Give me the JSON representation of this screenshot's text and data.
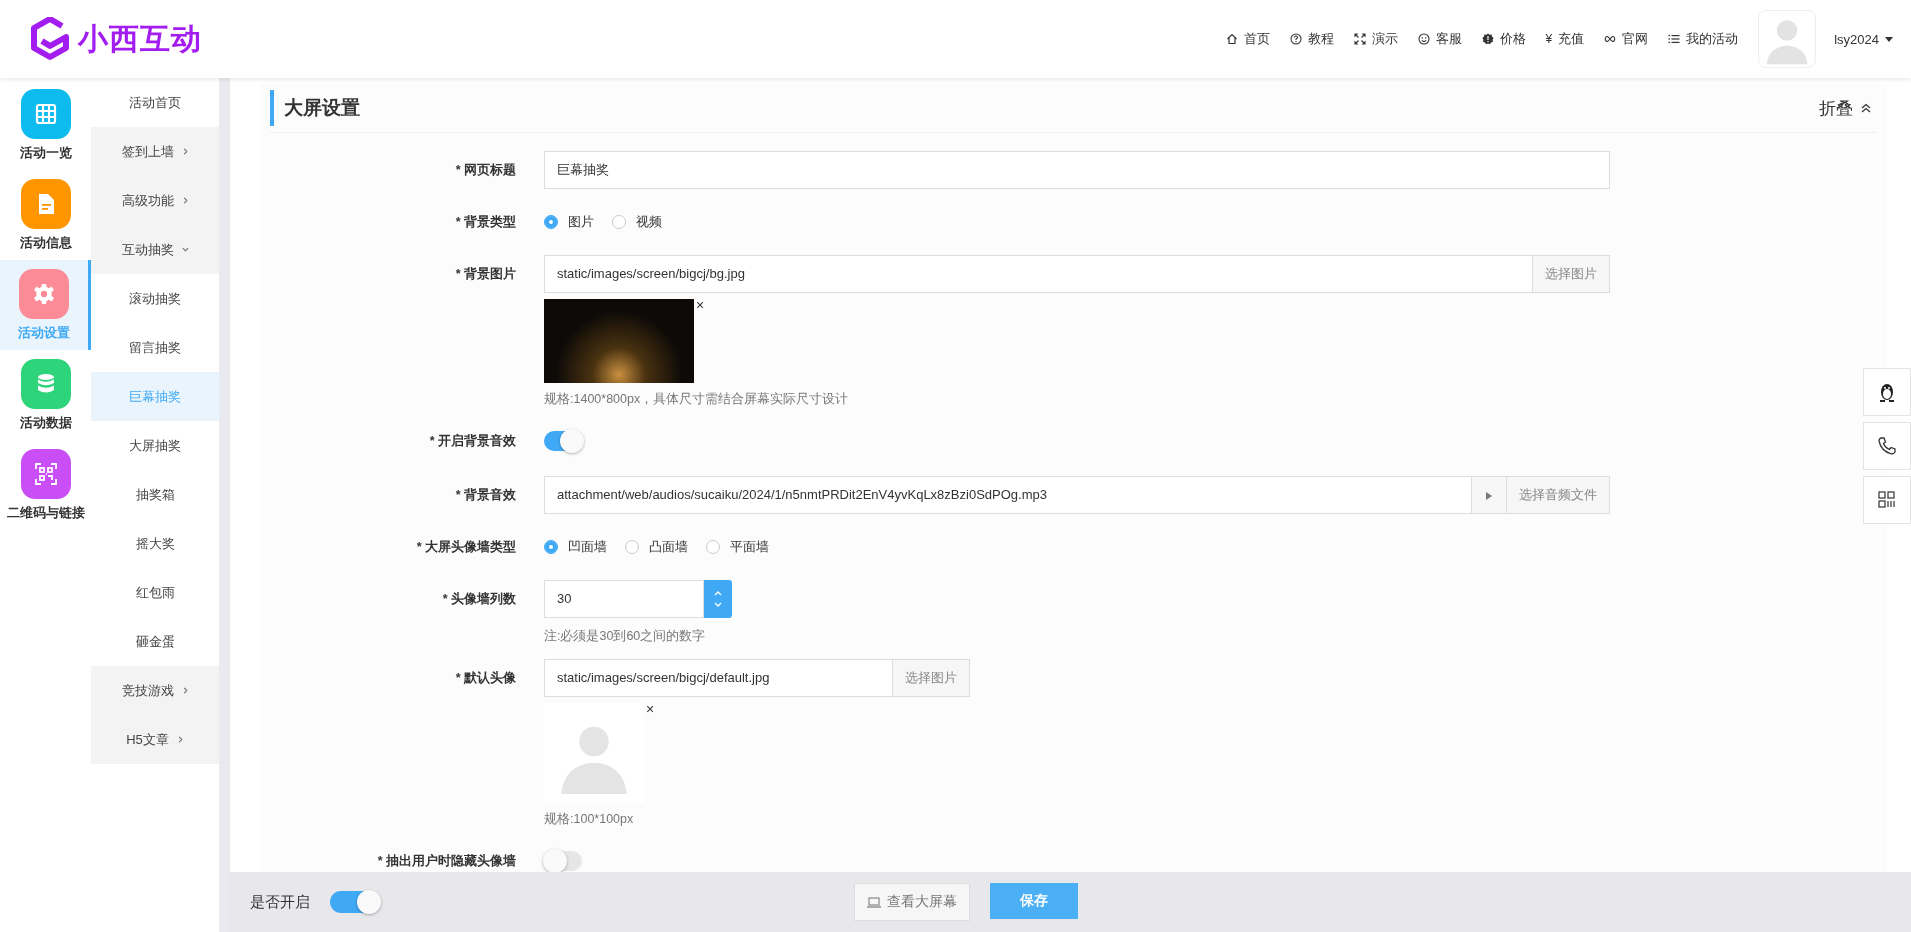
{
  "logo": {
    "text": "小西互动"
  },
  "top_nav": [
    {
      "label": "首页"
    },
    {
      "label": "教程"
    },
    {
      "label": "演示"
    },
    {
      "label": "客服"
    },
    {
      "label": "价格"
    },
    {
      "label": "充值",
      "glyph": "¥"
    },
    {
      "label": "官网"
    },
    {
      "label": "我的活动"
    }
  ],
  "user": {
    "name": "lsy2024"
  },
  "main_menu": [
    {
      "label": "活动一览",
      "color": "#0dbbee",
      "selected": false
    },
    {
      "label": "活动信息",
      "color": "#ff9500",
      "selected": false
    },
    {
      "label": "活动设置",
      "color": "#fd8a97",
      "selected": true
    },
    {
      "label": "活动数据",
      "color": "#2ed47a",
      "selected": false
    },
    {
      "label": "二维码与链接",
      "color": "#c94ef5",
      "selected": false
    }
  ],
  "sub_menu": [
    {
      "label": "活动首页",
      "selected": false
    },
    {
      "label": "签到上墙",
      "selected": false,
      "expanded": false
    },
    {
      "label": "高级功能",
      "selected": false,
      "expanded": false
    },
    {
      "label": "互动抽奖",
      "selected": false,
      "expanded": true,
      "children": [
        {
          "label": "滚动抽奖",
          "selected": false
        },
        {
          "label": "留言抽奖",
          "selected": false
        },
        {
          "label": "巨幕抽奖",
          "selected": true
        },
        {
          "label": "大屏抽奖",
          "selected": false
        },
        {
          "label": "抽奖箱",
          "selected": false
        },
        {
          "label": "摇大奖",
          "selected": false
        },
        {
          "label": "红包雨",
          "selected": false
        },
        {
          "label": "砸金蛋",
          "selected": false
        }
      ]
    },
    {
      "label": "竞技游戏",
      "selected": false,
      "expanded": false
    },
    {
      "label": "H5文章",
      "selected": false,
      "expanded": false
    }
  ],
  "section": {
    "title": "大屏设置",
    "collapse": "折叠"
  },
  "fields": [
    {
      "kind": "text",
      "label": "* 网页标题",
      "value": "巨幕抽奖"
    },
    {
      "kind": "radio",
      "label": "* 背景类型",
      "options": [
        {
          "label": "图片",
          "selected": true
        },
        {
          "label": "视频",
          "selected": false
        }
      ]
    },
    {
      "kind": "image",
      "label": "* 背景图片",
      "value": "static/images/screen/bigcj/bg.jpg",
      "button": "选择图片",
      "remove": "×",
      "hint": "规格:1400*800px，具体尺寸需结合屏幕实际尺寸设计"
    },
    {
      "kind": "toggle",
      "label": "* 开启背景音效",
      "on": true
    },
    {
      "kind": "audio",
      "label": "* 背景音效",
      "value": "attachment/web/audios/sucaiku/2024/1/n5nmtPRDit2EnV4yvKqLx8zBzi0SdPOg.mp3",
      "button": "选择音频文件"
    },
    {
      "kind": "radio",
      "label": "* 大屏头像墙类型",
      "options": [
        {
          "label": "凹面墙",
          "selected": true
        },
        {
          "label": "凸面墙",
          "selected": false
        },
        {
          "label": "平面墙",
          "selected": false
        }
      ]
    },
    {
      "kind": "number",
      "label": "* 头像墙列数",
      "value": "30",
      "note": "注:必须是30到60之间的数字"
    },
    {
      "kind": "avatar",
      "label": "* 默认头像",
      "value": "static/images/screen/bigcj/default.jpg",
      "button": "选择图片",
      "remove": "×",
      "hint": "规格:100*100px"
    },
    {
      "kind": "toggle",
      "label": "* 抽出用户时隐藏头像墙",
      "on": false
    }
  ],
  "footer": {
    "enable_label": "是否开启",
    "enable_on": true,
    "preview_button": "查看大屏幕",
    "save_button": "保存"
  }
}
